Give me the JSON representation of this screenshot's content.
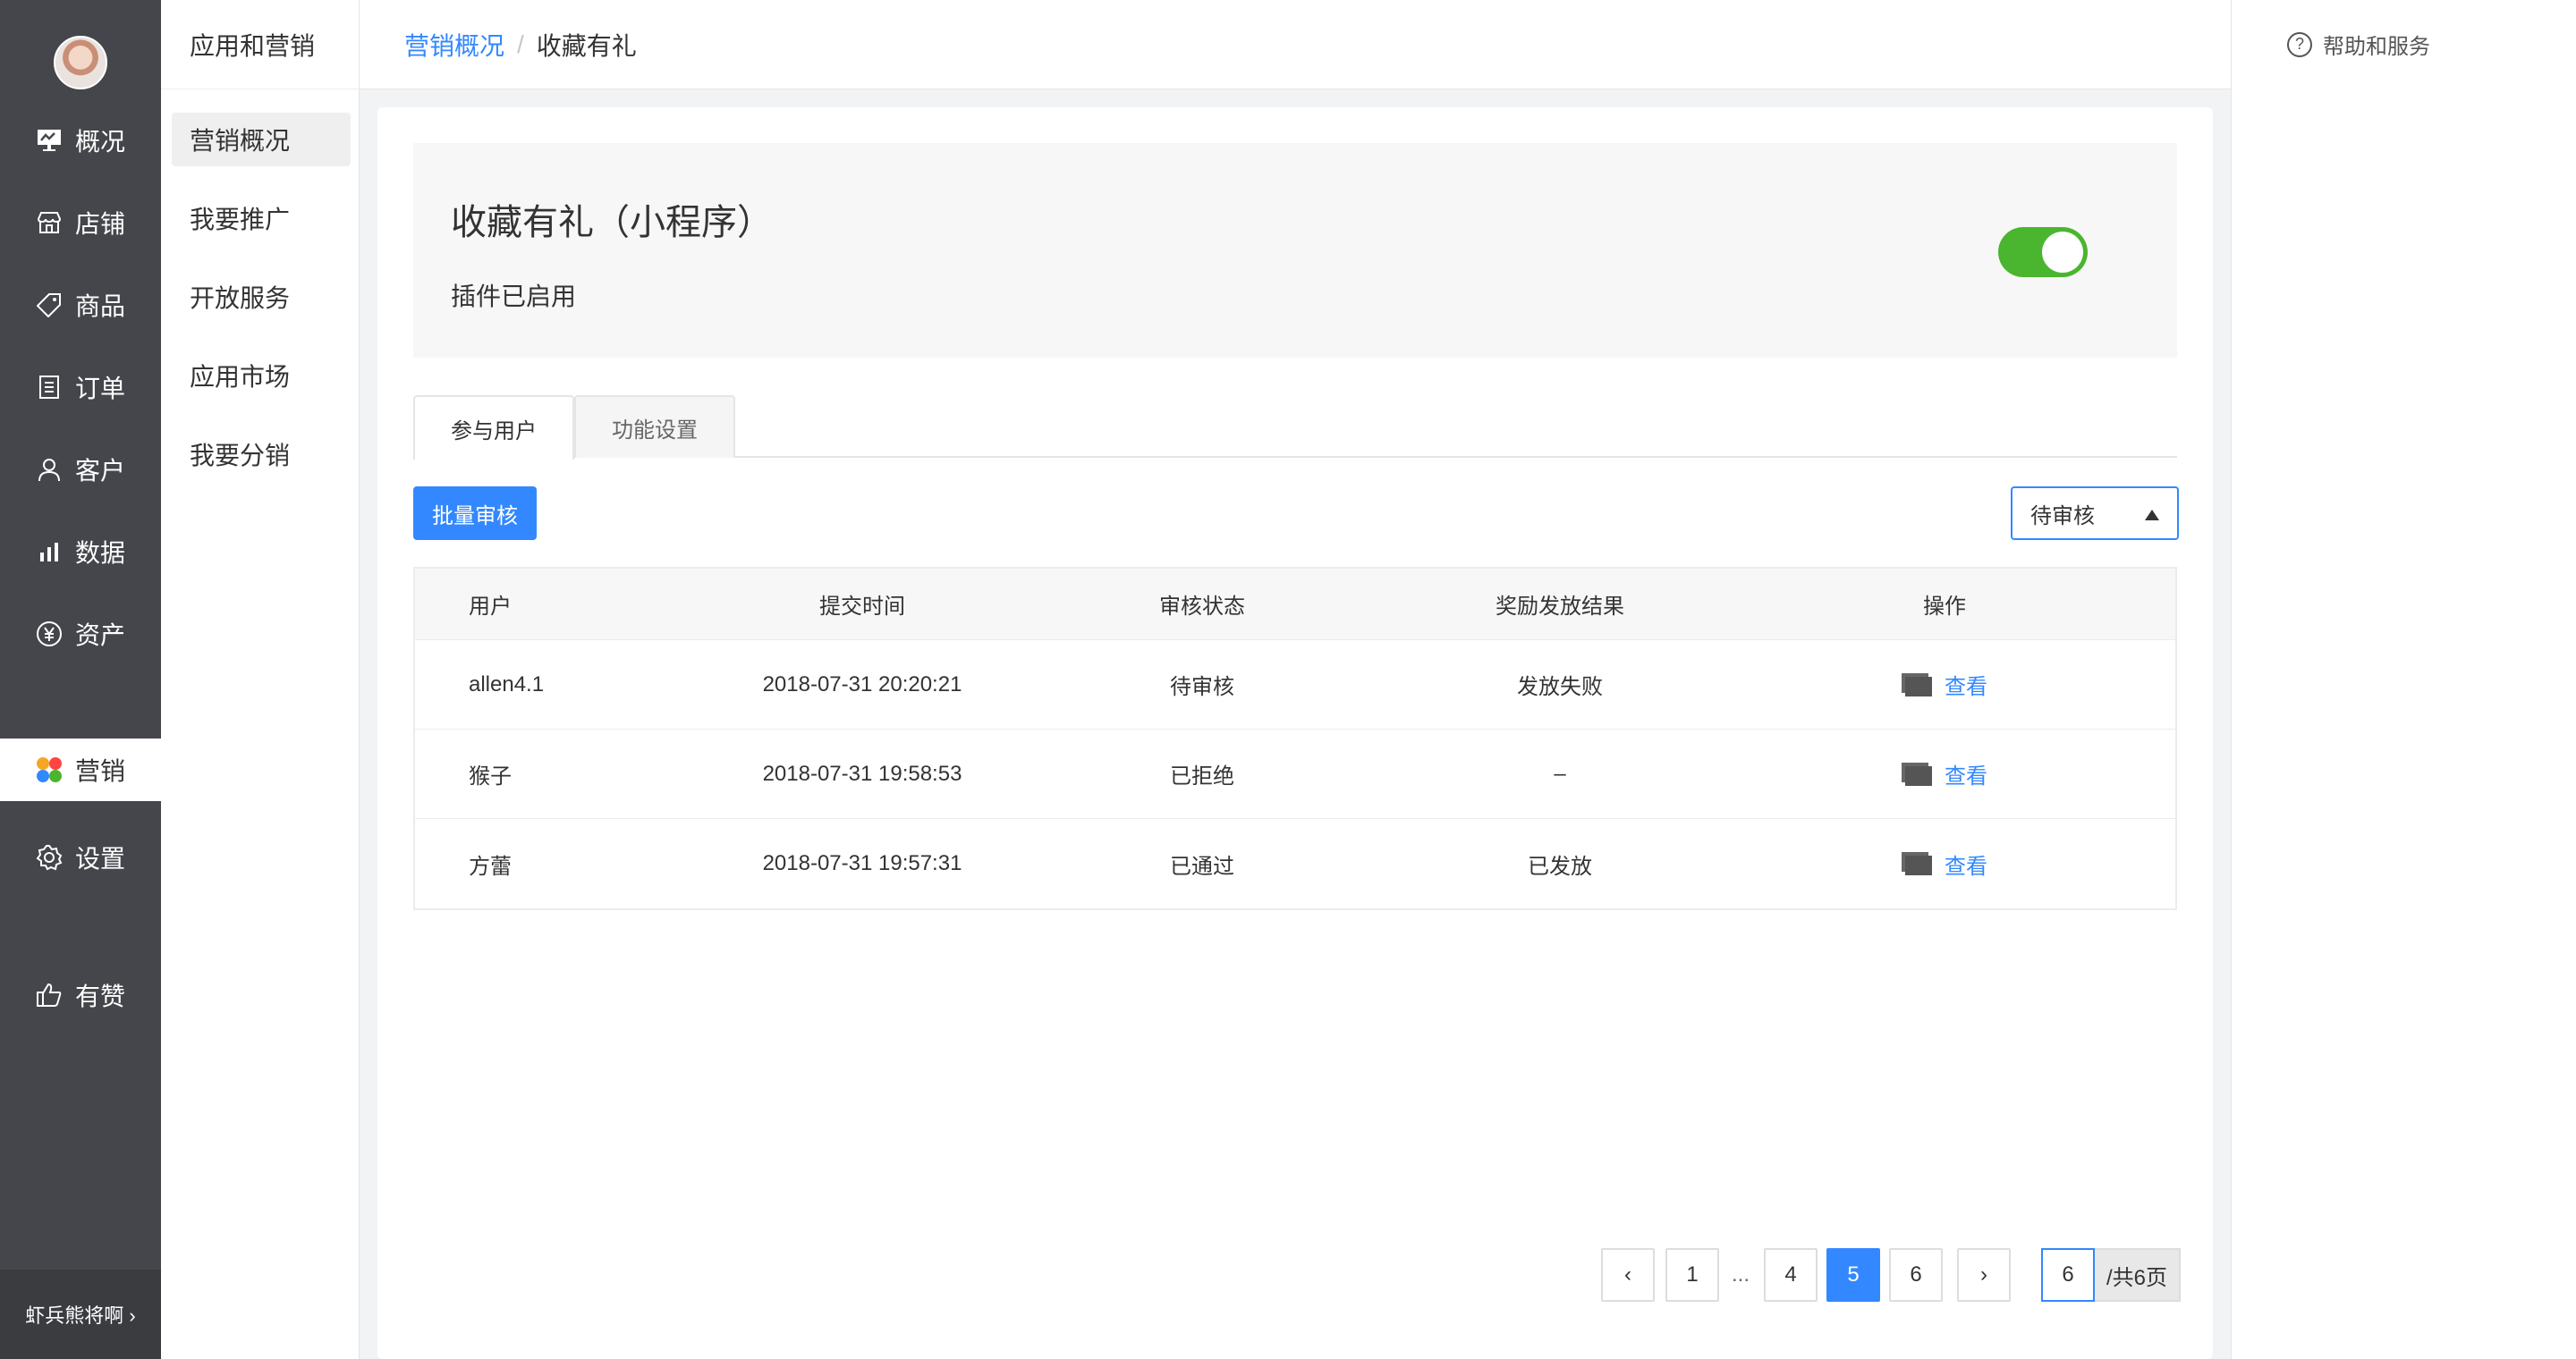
{
  "nav": {
    "items": [
      {
        "label": "概况",
        "icon": "overview-icon"
      },
      {
        "label": "店铺",
        "icon": "store-icon"
      },
      {
        "label": "商品",
        "icon": "tag-icon"
      },
      {
        "label": "订单",
        "icon": "order-icon"
      },
      {
        "label": "客户",
        "icon": "user-icon"
      },
      {
        "label": "数据",
        "icon": "chart-icon"
      },
      {
        "label": "资产",
        "icon": "yen-icon"
      },
      {
        "label": "营销",
        "icon": "marketing-icon"
      },
      {
        "label": "设置",
        "icon": "gear-icon"
      },
      {
        "label": "有赞",
        "icon": "thumbs-up-icon"
      }
    ],
    "footer": "虾兵熊将啊 ›"
  },
  "subnav": {
    "title": "应用和营销",
    "items": [
      "营销概况",
      "我要推广",
      "开放服务",
      "应用市场",
      "我要分销"
    ]
  },
  "breadcrumb": {
    "parent": "营销概况",
    "sep": "/",
    "current": "收藏有礼"
  },
  "help": {
    "label": "帮助和服务"
  },
  "banner": {
    "title": "收藏有礼（小程序）",
    "status": "插件已启用"
  },
  "tabs": [
    "参与用户",
    "功能设置"
  ],
  "toolbar": {
    "batch_button": "批量审核",
    "filter_value": "待审核"
  },
  "table": {
    "headers": [
      "用户",
      "提交时间",
      "审核状态",
      "奖励发放结果",
      "操作"
    ],
    "rows": [
      {
        "user": "allen4.1",
        "time": "2018-07-31 20:20:21",
        "status": "待审核",
        "result": "发放失败",
        "action": "查看"
      },
      {
        "user": "猴子",
        "time": "2018-07-31 19:58:53",
        "status": "已拒绝",
        "result": "–",
        "action": "查看"
      },
      {
        "user": "方蕾",
        "time": "2018-07-31 19:57:31",
        "status": "已通过",
        "result": "已发放",
        "action": "查看"
      }
    ]
  },
  "pagination": {
    "prev": "‹",
    "pages": [
      "1",
      "4",
      "5",
      "6"
    ],
    "ellipsis": "...",
    "current": "5",
    "next": "›",
    "jump_value": "6",
    "total": "/共6页"
  },
  "colors": {
    "accent": "#3388ff",
    "toggle_on": "#4ab52e",
    "nav_bg": "#44464b"
  }
}
